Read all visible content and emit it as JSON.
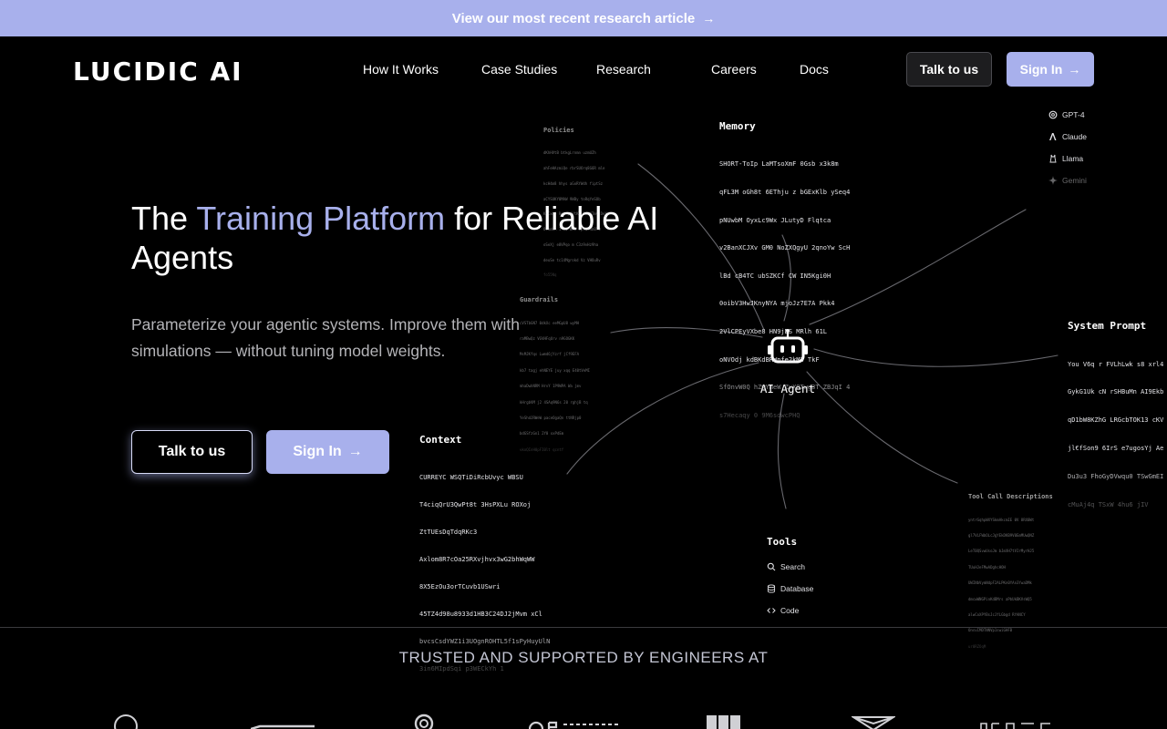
{
  "banner": {
    "text": "View our most recent research article",
    "arrow": "→"
  },
  "nav": {
    "logo": "LUCIDIC AI",
    "links": [
      "How It Works",
      "Case Studies",
      "Research",
      "Careers",
      "Docs"
    ],
    "talk_label": "Talk to us",
    "signin_label": "Sign In",
    "arrow": "→"
  },
  "hero": {
    "title_pre": "The ",
    "title_highlight": "Training Platform",
    "title_post": " for Reliable AI Agents",
    "subtitle": "Parameterize your agentic systems. Improve them with simulations — without tuning model weights.",
    "cta_talk": "Talk to us",
    "cta_signin": "Sign In",
    "arrow": "→"
  },
  "diagram": {
    "center": "AI Agent",
    "memory": {
      "title": "Memory",
      "lines": [
        "SHORT-ToIp LaMTsoXmF 0Gsb x3k8m",
        "qFL3M oGh8t 6EThju z bGExKlb ySeq4",
        "pNUwbM OyxLc9Wx JLutyD Flqtca",
        "v2BanXCJXv GM0 NoZXQgyU 2qnoYw ScH",
        "lBd cB4TC ubSZKCf CW IN5Kgi0H",
        "0oibV3HwJKnyNYA mjoJz7E7A Pkk4",
        "2VlCPEyVXbe8 HN9jDS MRlh 61L",
        "oNVOdj kdBKdBRWnfe2kM3 TkF",
        "SfOnvW0Q hZwYmeW ZvXQTwg3T ZBJqI 4",
        "s7Hecaqy 0 9M6sdwcPHQ"
      ]
    },
    "system_prompt": {
      "title": "System Prompt",
      "lines": [
        "You V6q r FVLhLwk s8 xrl4",
        "GykG1Uk cN rSHBuMn AI9Ekb",
        "qD1bW8KZhG LRGcbTOK13 cKV",
        "jl€fSon9 6IrS e7ugosYj Ae",
        "Du3u3 FhoGyDVwqu0 TSwGmEI",
        "cMuAj4q TSxW 4hu6 jIV"
      ]
    },
    "context": {
      "title": "Context",
      "lines": [
        "CURREYC WSQTiDiRcbUvyc WBSU",
        "T4ciqQrU3QwPt8t 3HsPXLu ROXoj",
        "ZtTUEsDqTdqRKc3",
        "Axlom8R7cOa25RXvjhvx3wG2bhWqWW",
        "8X5EzOu3orTCuvb1USwri",
        "45TZ4d98u8933d1HB3C24DJ2jMvm xCl",
        "bvcsCsdYWZ1i3UOgnROHTL5f1sPyHuyUlN",
        "3in6MIpdSqi p3WECkYh 1"
      ]
    },
    "policies": {
      "title": "Policies",
      "lines": [
        "dKhHVtB btkgLrnmn uzmUZh",
        "ahFeHAzmiQe rbrSUOrq8G6R mle",
        "kcH4m8 hhys aGoRYWdh fiptSz",
        "aCYSUKY0MAW 9WBy toRqYeSOb",
        "KsCxm6 Rqh pdVtKL S9dYTmv DeYr",
        "OcmmWA 1 f1 WK8 bptKf4b0T0",
        "oSeXj e0VPqo m C3z9vHz9ha",
        "deuSe tc14Mgrokd Vz VHOuRv",
        "fo55Nq"
      ]
    },
    "guardrails": {
      "title": "Guardrails",
      "lines": [
        "cVSTbGN7 0dkXc eeMGpU8 wyMH",
        "raMBwQz VGVHFqUrv n9GOGKK",
        "MsMJKfqs Lwmd6jYzrf jCf9EFA",
        "kb7 tagj ehNEYE juy xqq E40tVeMI",
        "mhaDwhNRM HrvY 1P9WPA Wa jmv",
        "kHrgbVM j2 4SAq9N6s 20 rghjB tq",
        "YeShdJRWeW paceOgaQn ttNRjp0",
        "bdGSfzGn1 2Y0 xxPdEm",
        "vkoQInH0pFI0lt qcntf"
      ]
    },
    "tool_call": {
      "title": "Tool Call Descriptions",
      "lines": [
        "yntrGqhpWXYSkmAkcmIE 0V 8RX0Wt",
        "gl7VLFWbOLcJgYEkDKB9V0EmMUwQNZ",
        "LeT0QSvwUsoJm bJmXH7tVIrMyrHJ5",
        "TUuHJeFMwADghcHOH",
        "UWINbVymNdpF2ALPKn0YAn3YwaDMk",
        "dmcwWNGPinKdBMrs aPbUkBKVsWQ5",
        "alwCoXPYBsJcJfLGbgd RYANCY",
        "OnsvIMDTNNVp1swiGHFB",
        "ur0RZOqM"
      ]
    },
    "models": [
      {
        "name": "GPT-4",
        "icon": "openai-icon"
      },
      {
        "name": "Claude",
        "icon": "anthropic-icon"
      },
      {
        "name": "Llama",
        "icon": "llama-icon"
      },
      {
        "name": "Gemini",
        "icon": "gemini-icon"
      }
    ],
    "tools": {
      "title": "Tools",
      "items": [
        {
          "name": "Search",
          "icon": "search-icon"
        },
        {
          "name": "Database",
          "icon": "database-icon"
        },
        {
          "name": "Code",
          "icon": "code-icon"
        }
      ]
    }
  },
  "trusted": {
    "heading": "TRUSTED AND SUPPORTED BY ENGINEERS AT"
  },
  "colors": {
    "accent": "#a8b0ec",
    "background": "#000000",
    "muted_text": "#b4b4b8"
  }
}
